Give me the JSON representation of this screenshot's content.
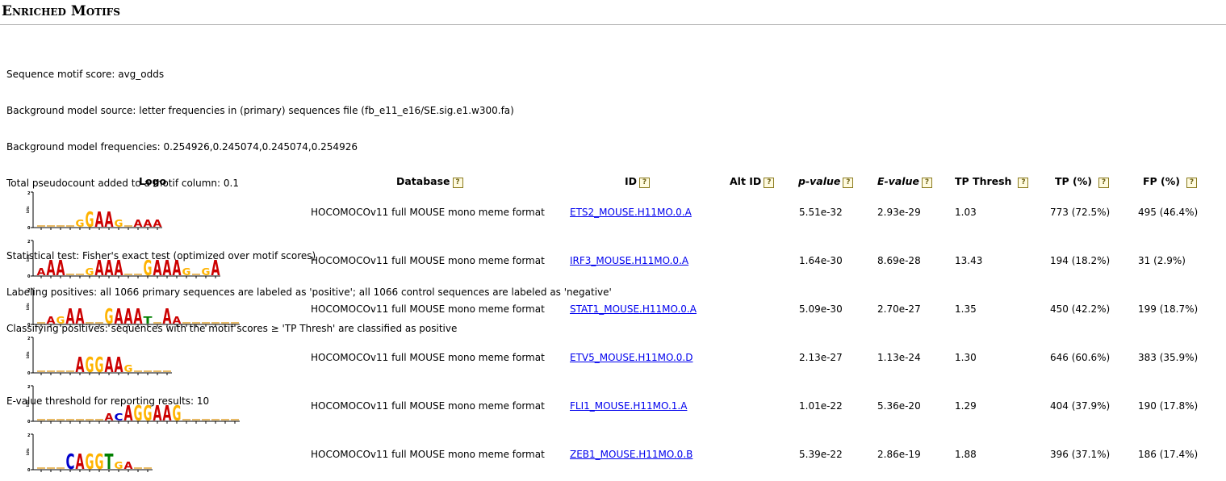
{
  "title": "Enriched Motifs",
  "info_lines": [
    "Sequence motif score: avg_odds",
    "Background model source: letter frequencies in (primary) sequences file (fb_e11_e16/SE.sig.e1.w300.fa)",
    "Background model frequencies: 0.254926,0.245074,0.245074,0.254926",
    "Total pseudocount added to a motif column: 0.1",
    "",
    "Statistical test: Fisher's exact test (optimized over motif scores)",
    "Labeling positives: all 1066 primary sequences are labeled as 'positive'; all 1066 control sequences are labeled as 'negative'",
    "Classifying positives: sequences with the motif scores ≥ 'TP Thresh' are classified as positive",
    "",
    "E-value threshold for reporting results: 10"
  ],
  "help_glyph": "?",
  "headers": {
    "logo": "Logo",
    "database": "Database",
    "id": "ID",
    "alt_id": "Alt ID",
    "pvalue": "p-value",
    "evalue": "E-value",
    "tp_thresh": "TP Thresh",
    "tp": "TP (%)",
    "fp": "FP (%)"
  },
  "logo_axis": {
    "top": "2",
    "bottom": "0",
    "unit": "bits"
  },
  "rows": [
    {
      "database": "HOCOMOCOv11 full MOUSE mono meme format",
      "id": "ETS2_MOUSE.H11MO.0.A",
      "alt_id": "",
      "pvalue": "5.51e-32",
      "evalue": "2.93e-29",
      "tp_thresh": "1.03",
      "tp": "773 (72.5%)",
      "fp": "495 (46.4%)"
    },
    {
      "database": "HOCOMOCOv11 full MOUSE mono meme format",
      "id": "IRF3_MOUSE.H11MO.0.A",
      "alt_id": "",
      "pvalue": "1.64e-30",
      "evalue": "8.69e-28",
      "tp_thresh": "13.43",
      "tp": "194 (18.2%)",
      "fp": "31 (2.9%)"
    },
    {
      "database": "HOCOMOCOv11 full MOUSE mono meme format",
      "id": "STAT1_MOUSE.H11MO.0.A",
      "alt_id": "",
      "pvalue": "5.09e-30",
      "evalue": "2.70e-27",
      "tp_thresh": "1.35",
      "tp": "450 (42.2%)",
      "fp": "199 (18.7%)"
    },
    {
      "database": "HOCOMOCOv11 full MOUSE mono meme format",
      "id": "ETV5_MOUSE.H11MO.0.D",
      "alt_id": "",
      "pvalue": "2.13e-27",
      "evalue": "1.13e-24",
      "tp_thresh": "1.30",
      "tp": "646 (60.6%)",
      "fp": "383 (35.9%)"
    },
    {
      "database": "HOCOMOCOv11 full MOUSE mono meme format",
      "id": "FLI1_MOUSE.H11MO.1.A",
      "alt_id": "",
      "pvalue": "1.01e-22",
      "evalue": "5.36e-20",
      "tp_thresh": "1.29",
      "tp": "404 (37.9%)",
      "fp": "190 (17.8%)"
    },
    {
      "database": "HOCOMOCOv11 full MOUSE mono meme format",
      "id": "ZEB1_MOUSE.H11MO.0.B",
      "alt_id": "",
      "pvalue": "5.39e-22",
      "evalue": "2.86e-19",
      "tp_thresh": "1.88",
      "tp": "396 (37.1%)",
      "fp": "186 (17.4%)"
    }
  ],
  "logos": [
    {
      "letters": [
        "",
        "",
        "",
        "",
        "g",
        "G",
        "A",
        "A",
        "g",
        "",
        "a",
        "a",
        "a"
      ]
    },
    {
      "letters": [
        "a",
        "A",
        "A",
        "",
        "",
        "g",
        "A",
        "A",
        "A",
        "",
        "",
        "G",
        "A",
        "A",
        "A",
        "g",
        "",
        "g",
        "A"
      ]
    },
    {
      "letters": [
        "",
        "a",
        "g",
        "A",
        "A",
        "",
        "",
        "G",
        "A",
        "A",
        "A",
        "t",
        "",
        "A",
        "a",
        "",
        "",
        "",
        "",
        "",
        ""
      ]
    },
    {
      "letters": [
        "",
        "",
        "",
        "",
        "A",
        "G",
        "G",
        "A",
        "A",
        "g",
        "",
        "",
        "",
        ""
      ]
    },
    {
      "letters": [
        "",
        "",
        "",
        "",
        "",
        "",
        "",
        "a",
        "c",
        "A",
        "G",
        "G",
        "A",
        "A",
        "G",
        "",
        "",
        "",
        "",
        "",
        ""
      ]
    },
    {
      "letters": [
        "",
        "",
        "",
        "C",
        "A",
        "G",
        "G",
        "T",
        "g",
        "a",
        "",
        ""
      ]
    }
  ],
  "colors": {
    "A": "#cc0000",
    "C": "#0000cc",
    "G": "#ffb300",
    "T": "#008000",
    "link": "#0000ee",
    "help_border": "#8a7a1d"
  }
}
